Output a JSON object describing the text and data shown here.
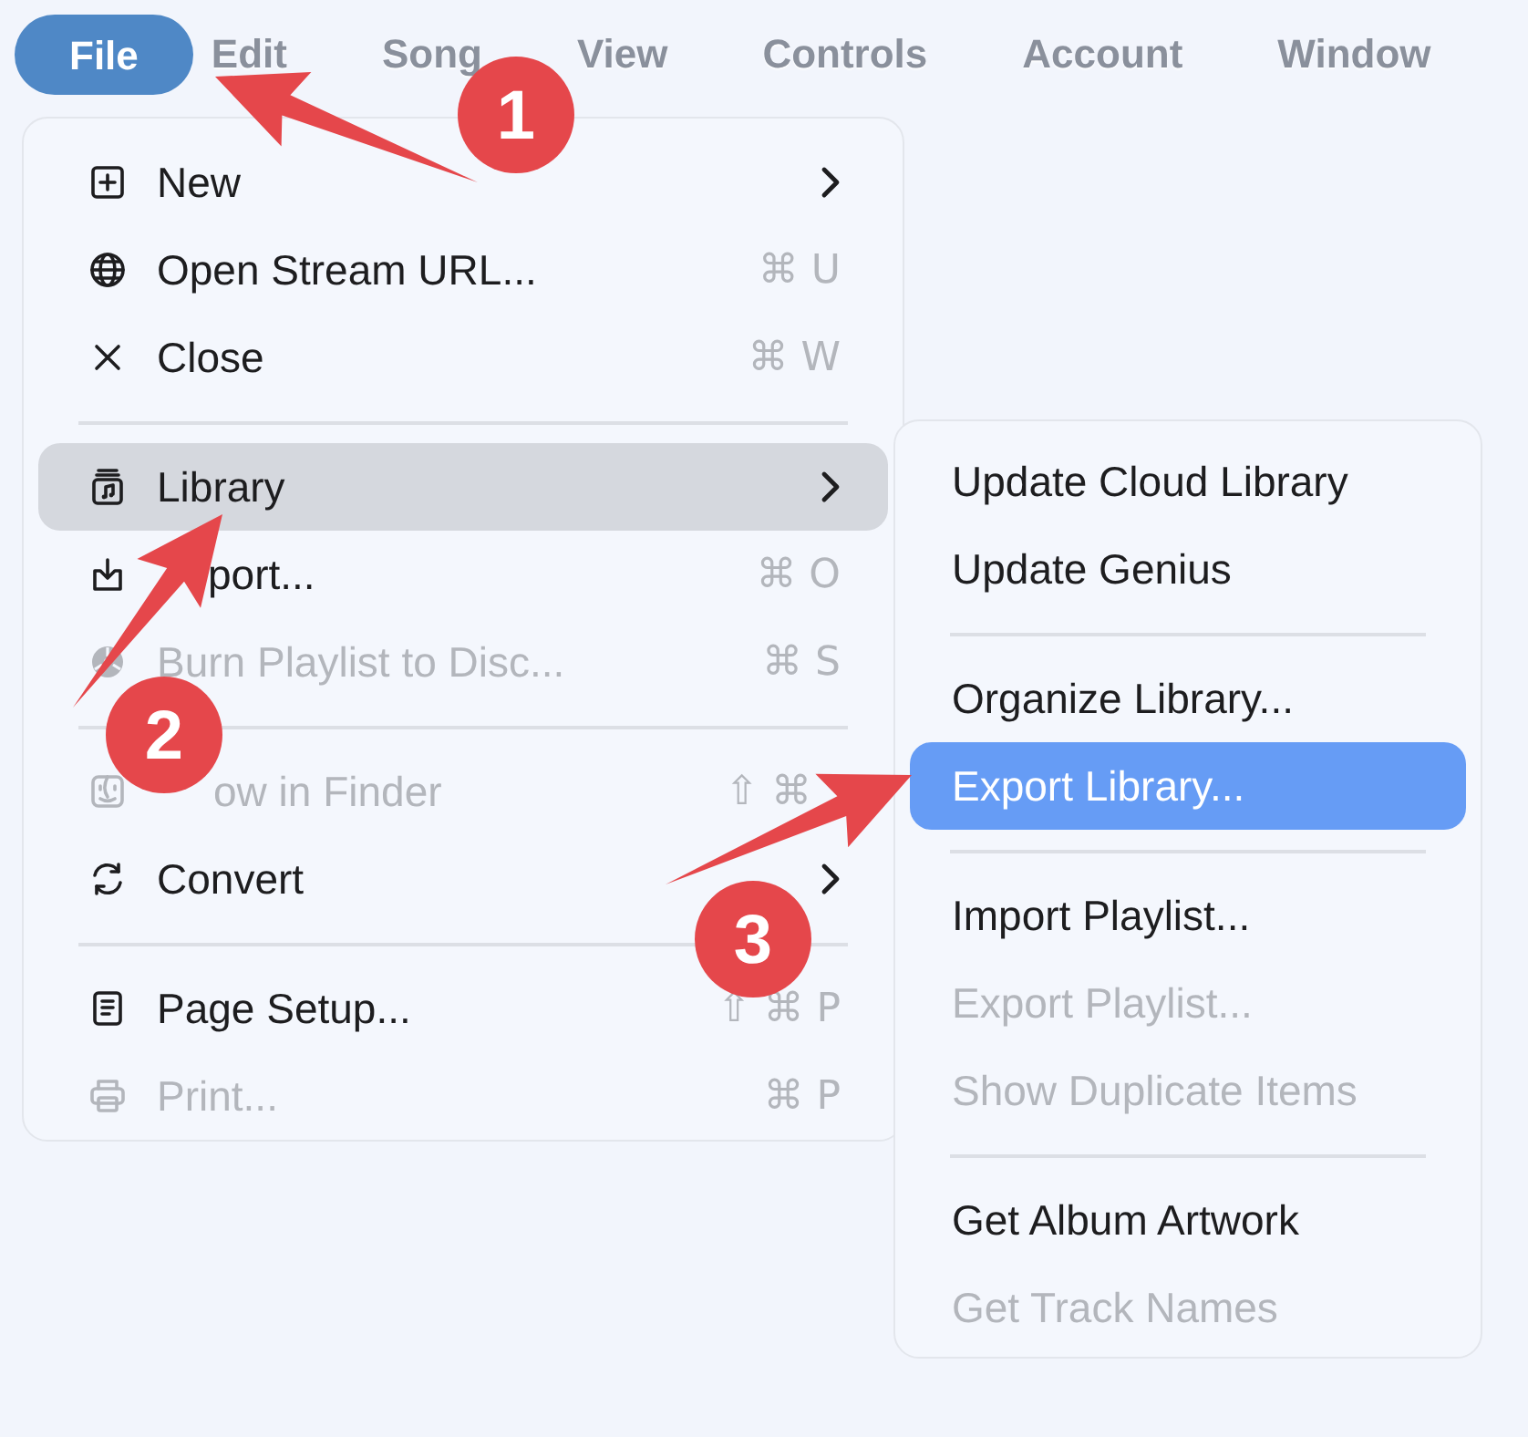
{
  "menu_bar": [
    {
      "label": "File",
      "selected": true
    },
    {
      "label": "Edit",
      "selected": false
    },
    {
      "label": "Song",
      "selected": false
    },
    {
      "label": "View",
      "selected": false
    },
    {
      "label": "Controls",
      "selected": false
    },
    {
      "label": "Account",
      "selected": false
    },
    {
      "label": "Window",
      "selected": false
    }
  ],
  "file_menu": [
    {
      "kind": "item",
      "label": "New",
      "submenu": true,
      "disabled": false,
      "selected": false
    },
    {
      "kind": "item",
      "label": "Open Stream URL...",
      "shortcut": "⌘ U",
      "disabled": false,
      "selected": false
    },
    {
      "kind": "item",
      "label": "Close",
      "shortcut": "⌘ W",
      "disabled": false,
      "selected": false
    },
    {
      "kind": "separator"
    },
    {
      "kind": "item",
      "label": "Library",
      "submenu": true,
      "disabled": false,
      "selected": true
    },
    {
      "kind": "item",
      "label": "port...",
      "shortcut": "⌘ O",
      "disabled": false,
      "selected": false
    },
    {
      "kind": "item",
      "label": "Burn Playlist to Disc...",
      "shortcut": "⌘ S",
      "disabled": true,
      "selected": false
    },
    {
      "kind": "separator"
    },
    {
      "kind": "item",
      "label": "ow in Finder",
      "shortcut": "⇧ ⌘",
      "disabled": true,
      "selected": false
    },
    {
      "kind": "item",
      "label": "Convert",
      "submenu": true,
      "disabled": false,
      "selected": false
    },
    {
      "kind": "separator"
    },
    {
      "kind": "item",
      "label": "Page Setup...",
      "shortcut": "⇧ ⌘ P",
      "disabled": false,
      "selected": false
    },
    {
      "kind": "item",
      "label": "Print...",
      "shortcut": "⌘ P",
      "disabled": true,
      "selected": false
    }
  ],
  "library_submenu": [
    {
      "kind": "item",
      "label": "Update Cloud Library",
      "disabled": false,
      "selected": false
    },
    {
      "kind": "item",
      "label": "Update Genius",
      "disabled": false,
      "selected": false
    },
    {
      "kind": "separator"
    },
    {
      "kind": "item",
      "label": "Organize Library...",
      "disabled": false,
      "selected": false
    },
    {
      "kind": "item",
      "label": "Export Library...",
      "disabled": false,
      "selected": true
    },
    {
      "kind": "separator"
    },
    {
      "kind": "item",
      "label": "Import Playlist...",
      "disabled": false,
      "selected": false
    },
    {
      "kind": "item",
      "label": "Export Playlist...",
      "disabled": true,
      "selected": false
    },
    {
      "kind": "item",
      "label": "Show Duplicate Items",
      "disabled": true,
      "selected": false
    },
    {
      "kind": "separator"
    },
    {
      "kind": "item",
      "label": "Get Album Artwork",
      "disabled": false,
      "selected": false
    },
    {
      "kind": "item",
      "label": "Get Track Names",
      "disabled": true,
      "selected": false
    }
  ],
  "annotations": [
    {
      "number": "1"
    },
    {
      "number": "2"
    },
    {
      "number": "3"
    }
  ]
}
